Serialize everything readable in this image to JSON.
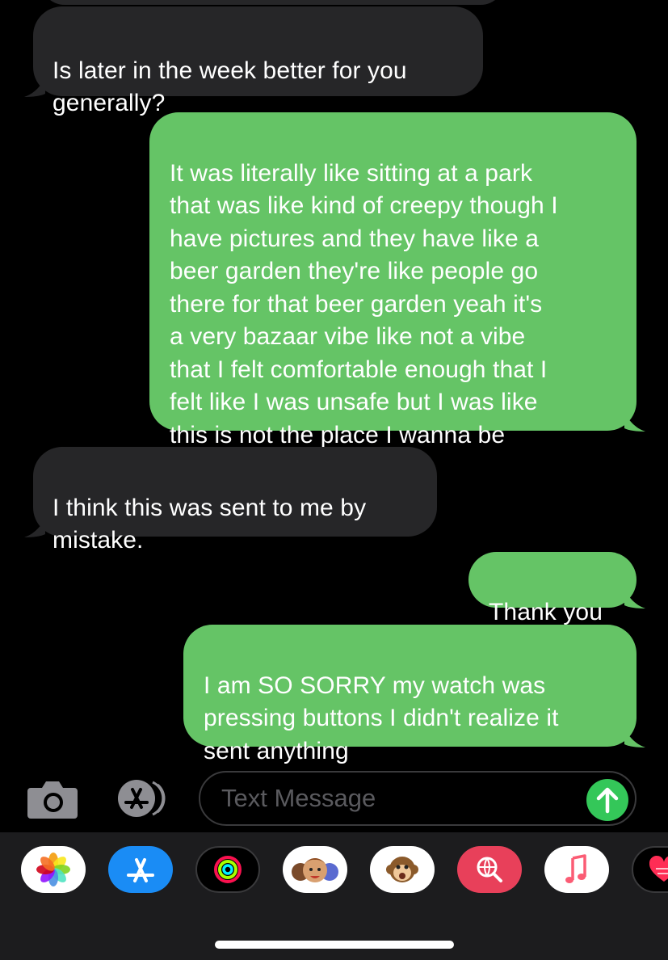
{
  "messages": [
    {
      "id": "m1",
      "direction": "received",
      "text": "Is later in the week better for you\ngenerally?"
    },
    {
      "id": "m2",
      "direction": "sent",
      "text": "It was literally like sitting at a park\nthat was like kind of creepy though I\nhave pictures and they have like a\nbeer garden they're like people go\nthere for that beer garden yeah it's\na very bazaar vibe like not a vibe\nthat I felt comfortable enough that I\nfelt like I was unsafe but I was like\nthis is not the place I wanna be"
    },
    {
      "id": "m3",
      "direction": "received",
      "text": "I think this was sent to me by\nmistake."
    },
    {
      "id": "m4",
      "direction": "sent",
      "text": "Thank you"
    },
    {
      "id": "m5",
      "direction": "sent",
      "text": "I am SO SORRY my watch was\npressing buttons I didn't realize it\nsent anything"
    }
  ],
  "composer": {
    "placeholder": "Text Message",
    "camera_icon": "camera-icon",
    "apps_icon": "app-store-icon",
    "send_icon": "arrow-up-icon"
  },
  "app_drawer": [
    {
      "name": "Photos",
      "icon": "photos-icon"
    },
    {
      "name": "App Store",
      "icon": "app-store-icon"
    },
    {
      "name": "Activity",
      "icon": "activity-rings-icon"
    },
    {
      "name": "Memoji Stickers",
      "icon": "memoji-icon"
    },
    {
      "name": "Animoji",
      "icon": "monkey-icon"
    },
    {
      "name": "Images",
      "icon": "globe-search-icon"
    },
    {
      "name": "Music",
      "icon": "music-note-icon"
    },
    {
      "name": "Digital Touch",
      "icon": "heart-icon"
    }
  ],
  "colors": {
    "background": "#000000",
    "received_bubble": "#262628",
    "sent_bubble": "#65c466",
    "send_button": "#34c759",
    "drawer": "#1c1c1e"
  }
}
